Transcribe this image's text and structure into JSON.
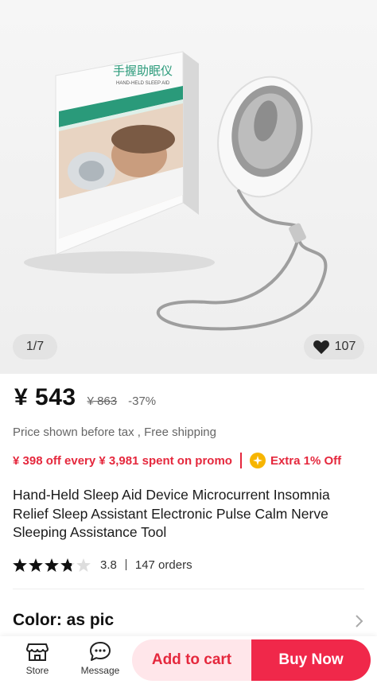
{
  "gallery": {
    "box_title_cn": "手握助眠仪",
    "box_title_en": "HAND-HELD SLEEP AID",
    "counter": "1/7",
    "likes": "107"
  },
  "price": {
    "current": "¥ 543",
    "original": "¥ 863",
    "discount": "-37%"
  },
  "tax_note": "Price shown before tax , Free shipping",
  "promo": {
    "coupon": "¥ 398 off every ¥ 3,981 spent on promo",
    "extra": "Extra 1% Off"
  },
  "product_title": "Hand-Held Sleep Aid Device Microcurrent Insomnia Relief Sleep Assistant Electronic Pulse Calm Nerve Sleeping Assistance Tool",
  "rating": {
    "stars": 3.8,
    "value": "3.8",
    "orders": "147 orders"
  },
  "variant": {
    "color_label": "Color: as pic"
  },
  "bottom_bar": {
    "store_label": "Store",
    "message_label": "Message",
    "add_to_cart": "Add to cart",
    "buy_now": "Buy Now"
  },
  "colors": {
    "accent_red": "#e5283d",
    "buy_button": "#f0284a",
    "cart_button_bg": "#ffe6ea",
    "coin_gold": "#f7b500"
  },
  "icons": [
    "heart-icon",
    "coin-icon",
    "star-icon",
    "store-icon",
    "message-icon",
    "chevron-right-icon"
  ]
}
